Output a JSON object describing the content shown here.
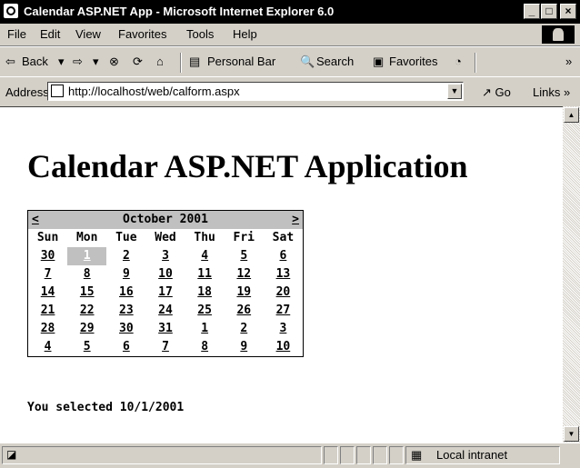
{
  "window": {
    "title": "Calendar ASP.NET App - Microsoft Internet Explorer 6.0",
    "controls": [
      "_",
      "□",
      "×"
    ]
  },
  "menu": [
    "File",
    "Edit",
    "View",
    "Favorites",
    "Tools",
    "Help"
  ],
  "toolbar": {
    "back": "Back",
    "personal_bar": "Personal Bar",
    "search": "Search",
    "favorites": "Favorites",
    "more": "»"
  },
  "address": {
    "label": "Address",
    "url": "http://localhost/web/calform.aspx",
    "go": "Go",
    "links": "Links »"
  },
  "page": {
    "heading": "Calendar ASP.NET Application",
    "calendar": {
      "prev": "<",
      "next": ">",
      "month": "October 2001",
      "day_headers": [
        "Sun",
        "Mon",
        "Tue",
        "Wed",
        "Thu",
        "Fri",
        "Sat"
      ],
      "days": [
        "30",
        "1",
        "2",
        "3",
        "4",
        "5",
        "6",
        "7",
        "8",
        "9",
        "10",
        "11",
        "12",
        "13",
        "14",
        "15",
        "16",
        "17",
        "18",
        "19",
        "20",
        "21",
        "22",
        "23",
        "24",
        "25",
        "26",
        "27",
        "28",
        "29",
        "30",
        "31",
        "1",
        "2",
        "3",
        "4",
        "5",
        "6",
        "7",
        "8",
        "9",
        "10"
      ],
      "selected_index": 1
    },
    "message": "You selected 10/1/2001"
  },
  "status": {
    "zone": "Local intranet"
  }
}
